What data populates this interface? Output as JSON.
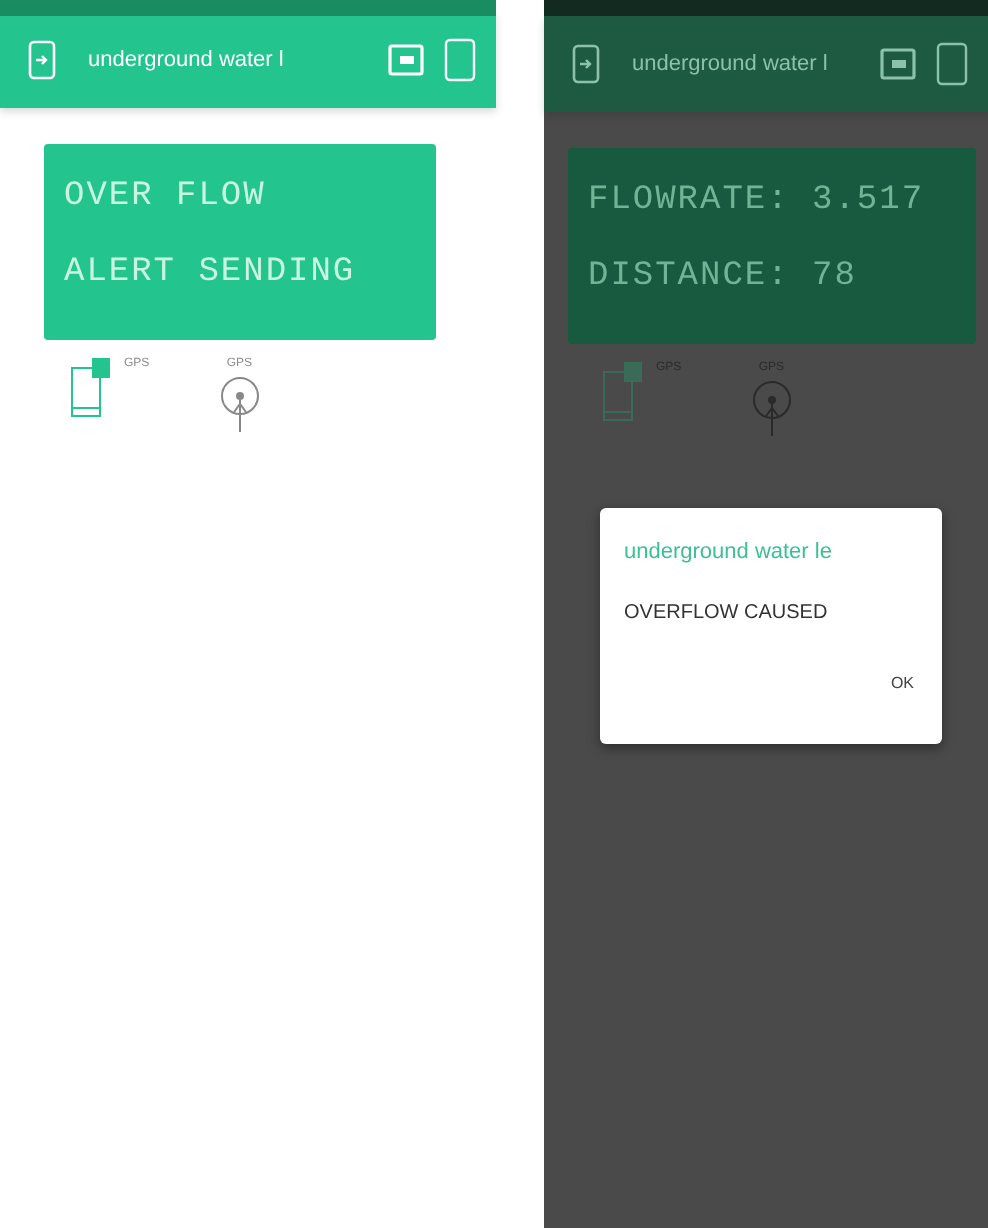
{
  "screens": [
    {
      "dimmed": false,
      "header": {
        "title": "underground water l"
      },
      "lcd": {
        "lines": [
          "OVER FLOW",
          "ALERT SENDING"
        ]
      },
      "widgets": [
        {
          "kind": "device",
          "label": "GPS"
        },
        {
          "kind": "location",
          "label": "GPS"
        }
      ]
    },
    {
      "dimmed": true,
      "header": {
        "title": "underground water l"
      },
      "lcd": {
        "lines": [
          "FLOWRATE: 3.517",
          "DISTANCE: 78"
        ]
      },
      "widgets": [
        {
          "kind": "device",
          "label": "GPS"
        },
        {
          "kind": "location",
          "label": "GPS"
        }
      ],
      "dialog": {
        "title": "underground water le",
        "message": "OVERFLOW CAUSED",
        "button": "OK"
      }
    }
  ]
}
